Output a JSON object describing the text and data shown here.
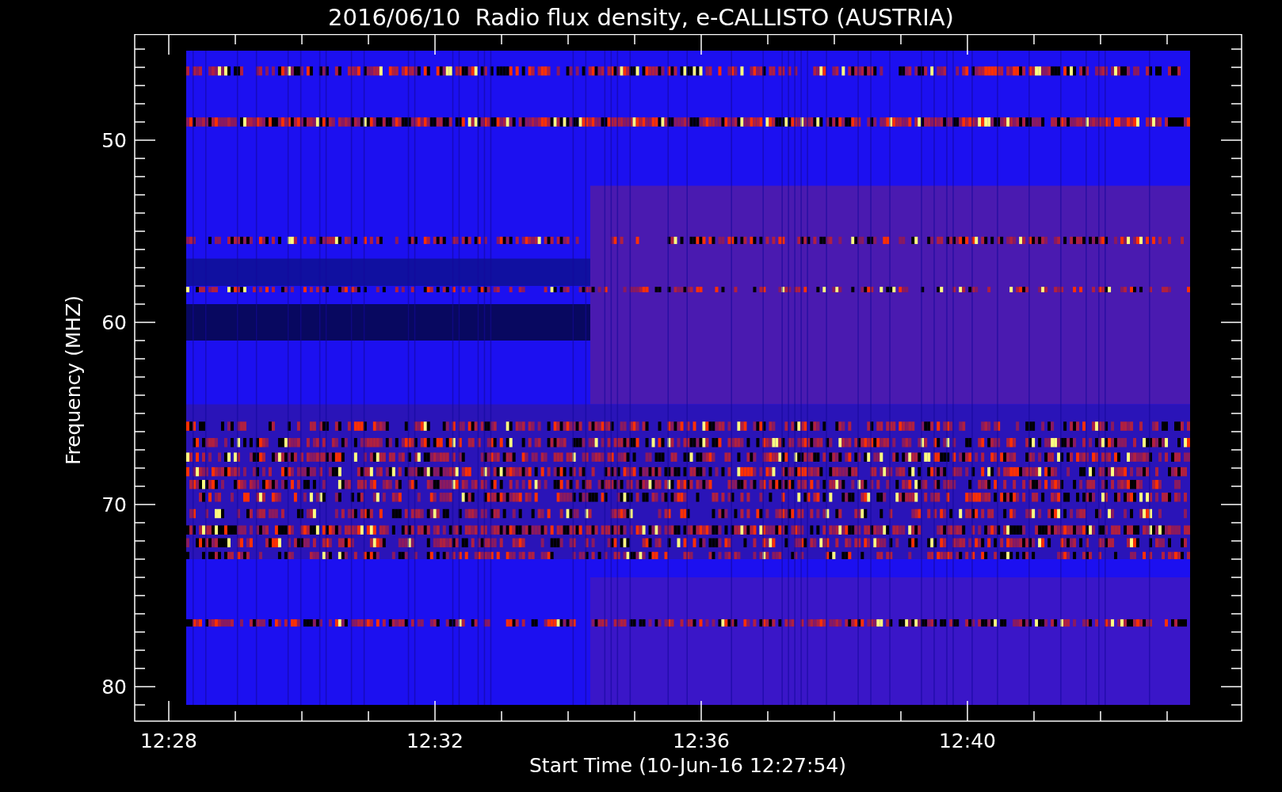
{
  "title": "2016/06/10  Radio flux density, e-CALLISTO (AUSTRIA)",
  "y_axis": {
    "label": "Frequency (MHZ)",
    "ticks": [
      "50",
      "60",
      "70",
      "80"
    ]
  },
  "x_axis": {
    "label": "Start Time (10-Jun-16 12:27:54)",
    "ticks": [
      "12:28",
      "12:32",
      "12:36",
      "12:40"
    ]
  }
}
